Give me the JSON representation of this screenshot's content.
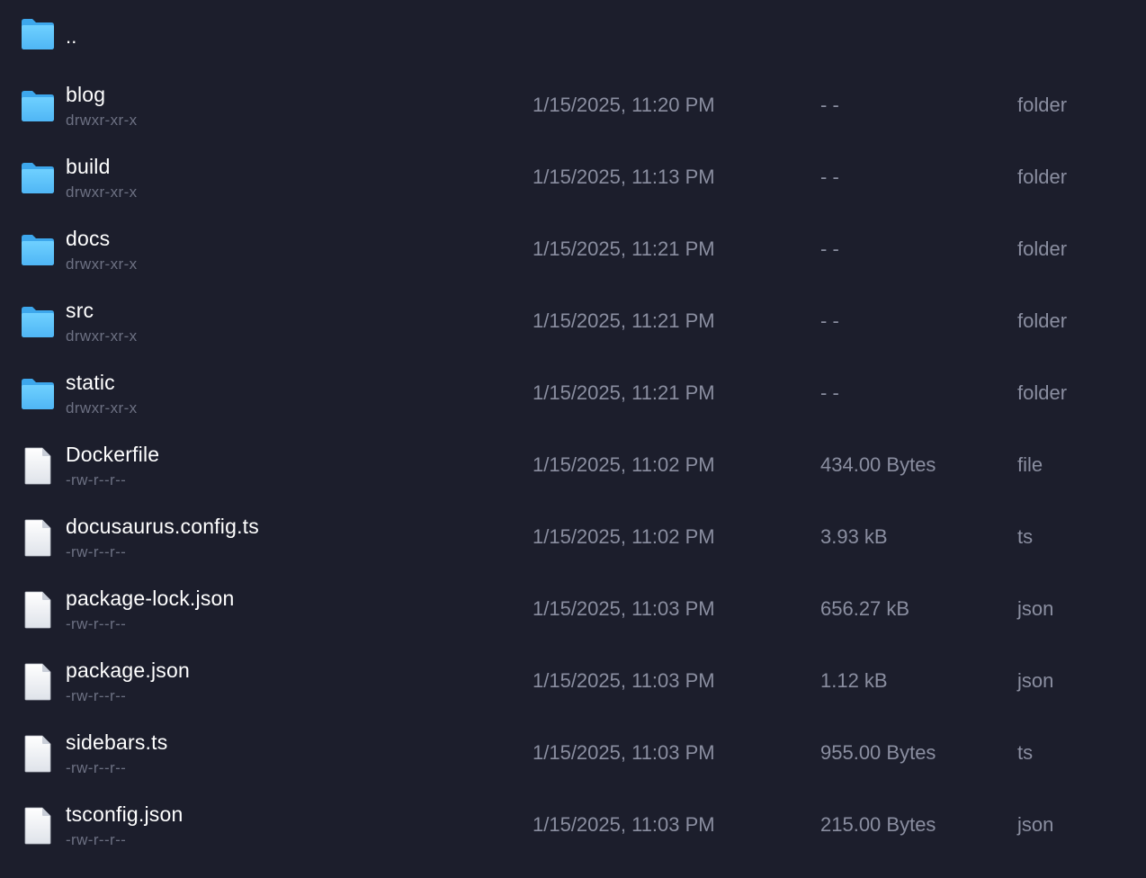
{
  "colors": {
    "background": "#1c1e2c",
    "name_text": "#ffffff",
    "meta_text": "#8a8ea0",
    "perm_text": "#6c7082",
    "folder_icon": "#5ac8fa"
  },
  "parent": {
    "name": "..",
    "icon": "folder-icon"
  },
  "entries": [
    {
      "name": "blog",
      "perms": "drwxr-xr-x",
      "modified": "1/15/2025, 11:20 PM",
      "size": "- -",
      "type": "folder",
      "icon": "folder-icon"
    },
    {
      "name": "build",
      "perms": "drwxr-xr-x",
      "modified": "1/15/2025, 11:13 PM",
      "size": "- -",
      "type": "folder",
      "icon": "folder-icon"
    },
    {
      "name": "docs",
      "perms": "drwxr-xr-x",
      "modified": "1/15/2025, 11:21 PM",
      "size": "- -",
      "type": "folder",
      "icon": "folder-icon"
    },
    {
      "name": "src",
      "perms": "drwxr-xr-x",
      "modified": "1/15/2025, 11:21 PM",
      "size": "- -",
      "type": "folder",
      "icon": "folder-icon"
    },
    {
      "name": "static",
      "perms": "drwxr-xr-x",
      "modified": "1/15/2025, 11:21 PM",
      "size": "- -",
      "type": "folder",
      "icon": "folder-icon"
    },
    {
      "name": "Dockerfile",
      "perms": "-rw-r--r--",
      "modified": "1/15/2025, 11:02 PM",
      "size": "434.00 Bytes",
      "type": "file",
      "icon": "file-icon"
    },
    {
      "name": "docusaurus.config.ts",
      "perms": "-rw-r--r--",
      "modified": "1/15/2025, 11:02 PM",
      "size": "3.93 kB",
      "type": "ts",
      "icon": "file-icon"
    },
    {
      "name": "package-lock.json",
      "perms": "-rw-r--r--",
      "modified": "1/15/2025, 11:03 PM",
      "size": "656.27 kB",
      "type": "json",
      "icon": "file-icon"
    },
    {
      "name": "package.json",
      "perms": "-rw-r--r--",
      "modified": "1/15/2025, 11:03 PM",
      "size": "1.12 kB",
      "type": "json",
      "icon": "file-icon"
    },
    {
      "name": "sidebars.ts",
      "perms": "-rw-r--r--",
      "modified": "1/15/2025, 11:03 PM",
      "size": "955.00 Bytes",
      "type": "ts",
      "icon": "file-icon"
    },
    {
      "name": "tsconfig.json",
      "perms": "-rw-r--r--",
      "modified": "1/15/2025, 11:03 PM",
      "size": "215.00 Bytes",
      "type": "json",
      "icon": "file-icon"
    }
  ]
}
